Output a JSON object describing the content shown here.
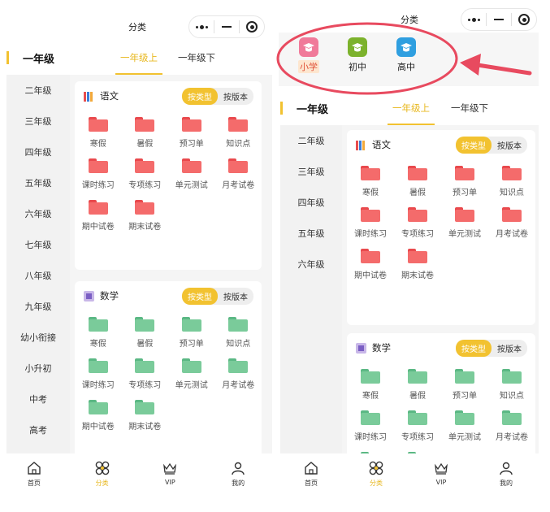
{
  "nav": {
    "title": "分类"
  },
  "grade": {
    "current": "一年级",
    "terms": [
      "一年级上",
      "一年级下"
    ]
  },
  "left_sidebar": [
    "二年级",
    "三年级",
    "四年级",
    "五年级",
    "六年级",
    "七年级",
    "八年级",
    "九年级",
    "幼小衔接",
    "小升初",
    "中考",
    "高考"
  ],
  "right_sidebar": [
    "二年级",
    "三年级",
    "四年级",
    "五年级",
    "六年级"
  ],
  "school_levels": [
    {
      "label": "小学",
      "color": "#f07a9a",
      "selected": true
    },
    {
      "label": "初中",
      "color": "#7cb22c",
      "selected": false
    },
    {
      "label": "高中",
      "color": "#2f9fe0",
      "selected": false
    }
  ],
  "subjects": [
    {
      "name": "语文",
      "toggle": [
        "按类型",
        "按版本"
      ],
      "folder_color": "red",
      "items": [
        "寒假",
        "暑假",
        "预习单",
        "知识点",
        "课时练习",
        "专项练习",
        "单元测试",
        "月考试卷",
        "期中试卷",
        "期末试卷"
      ]
    },
    {
      "name": "数学",
      "toggle": [
        "按类型",
        "按版本"
      ],
      "folder_color": "green",
      "items": [
        "寒假",
        "暑假",
        "预习单",
        "知识点",
        "课时练习",
        "专项练习",
        "单元测试",
        "月考试卷",
        "期中试卷",
        "期末试卷"
      ]
    }
  ],
  "tabbar": [
    {
      "label": "首页",
      "icon": "home-icon"
    },
    {
      "label": "分类",
      "icon": "category-icon",
      "active": true
    },
    {
      "label": "VIP",
      "icon": "crown-icon"
    },
    {
      "label": "我的",
      "icon": "profile-icon"
    }
  ],
  "colors": {
    "accent": "#f2c230",
    "annotation": "#e84a5f",
    "folder_red": "#f46b6b",
    "folder_green": "#7acb9a"
  }
}
